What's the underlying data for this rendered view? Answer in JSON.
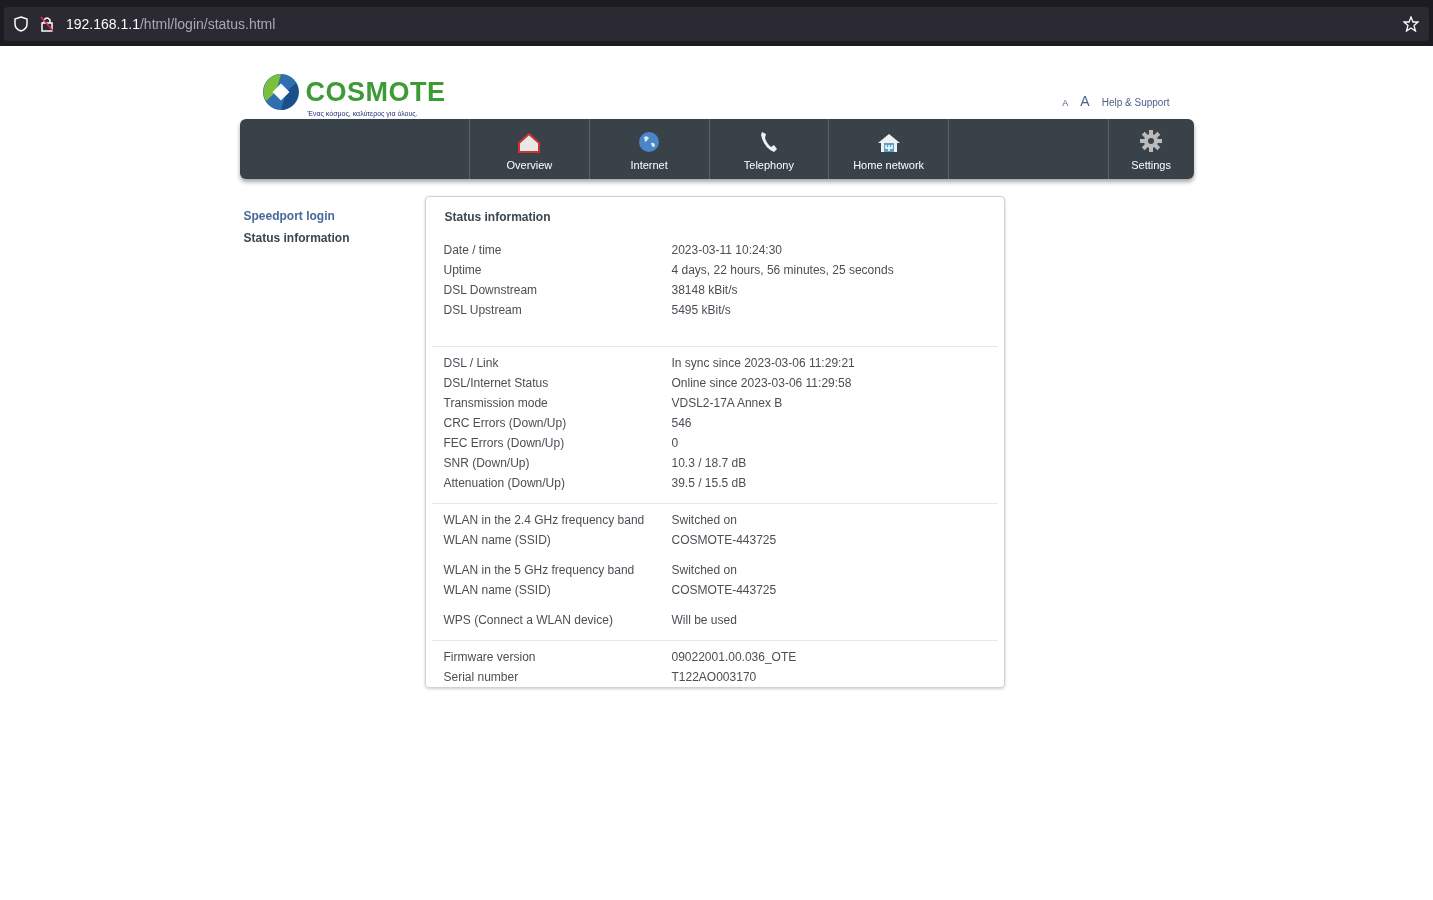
{
  "browser": {
    "url_host": "192.168.1.1",
    "url_path": "/html/login/status.html"
  },
  "header": {
    "brand": "COSMOTE",
    "tagline": "Ένας κόσμος, καλύτερος για όλους.",
    "font_small": "A",
    "font_large": "A",
    "help": "Help & Support"
  },
  "nav": [
    {
      "label": "Overview",
      "kind": "overview"
    },
    {
      "label": "Internet",
      "kind": "internet"
    },
    {
      "label": "Telephony",
      "kind": "telephony"
    },
    {
      "label": "Home network",
      "kind": "homenetwork"
    },
    {
      "label": "Settings",
      "kind": "settings"
    }
  ],
  "sidebar": {
    "items": [
      {
        "label": "Speedport login",
        "selected": false
      },
      {
        "label": "Status information",
        "selected": true
      }
    ]
  },
  "card": {
    "title": "Status information",
    "sections": [
      {
        "groups": [
          [
            {
              "label": "Date / time",
              "value": "2023-03-11 10:24:30"
            },
            {
              "label": "Uptime",
              "value": "4 days, 22 hours, 56 minutes, 25 seconds"
            },
            {
              "label": "DSL Downstream",
              "value": "38148 kBit/s"
            },
            {
              "label": "DSL Upstream",
              "value": "5495 kBit/s"
            }
          ]
        ]
      },
      {
        "groups": [
          [
            {
              "label": "DSL / Link",
              "value": "In sync since 2023-03-06 11:29:21"
            },
            {
              "label": "DSL/Internet Status",
              "value": "Online since 2023-03-06 11:29:58"
            },
            {
              "label": "Transmission mode",
              "value": "VDSL2-17A Annex B"
            },
            {
              "label": "CRC Errors (Down/Up)",
              "value": "546"
            },
            {
              "label": "FEC Errors (Down/Up)",
              "value": "0"
            },
            {
              "label": "SNR (Down/Up)",
              "value": "10.3 / 18.7 dB"
            },
            {
              "label": "Attenuation (Down/Up)",
              "value": "39.5 / 15.5 dB"
            }
          ]
        ]
      },
      {
        "groups": [
          [
            {
              "label": "WLAN in the 2.4 GHz frequency band",
              "value": "Switched on"
            },
            {
              "label": "WLAN name (SSID)",
              "value": "COSMOTE-443725"
            }
          ],
          [
            {
              "label": "WLAN in the 5 GHz frequency band",
              "value": "Switched on"
            },
            {
              "label": "WLAN name (SSID)",
              "value": "COSMOTE-443725"
            }
          ],
          [
            {
              "label": "WPS (Connect a WLAN device)",
              "value": "Will be used"
            }
          ]
        ]
      },
      {
        "groups": [
          [
            {
              "label": "Firmware version",
              "value": "09022001.00.036_OTE"
            },
            {
              "label": "Serial number",
              "value": "T122AO003170"
            }
          ]
        ]
      }
    ]
  }
}
